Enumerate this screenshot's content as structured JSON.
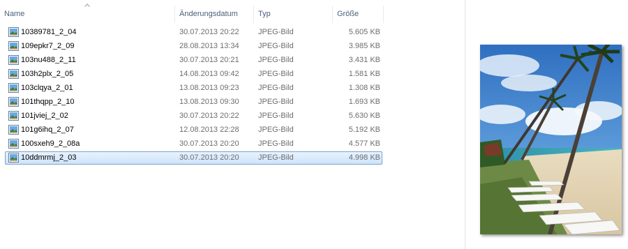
{
  "columns": {
    "name": "Name",
    "date": "Änderungsdatum",
    "type": "Typ",
    "size": "Größe"
  },
  "files": [
    {
      "name": "10389781_2_04",
      "date": "30.07.2013 20:22",
      "type": "JPEG-Bild",
      "size": "5.605 KB"
    },
    {
      "name": "109epkr7_2_09",
      "date": "28.08.2013 13:34",
      "type": "JPEG-Bild",
      "size": "3.985 KB"
    },
    {
      "name": "103nu488_2_11",
      "date": "30.07.2013 20:21",
      "type": "JPEG-Bild",
      "size": "3.431 KB"
    },
    {
      "name": "103h2plx_2_05",
      "date": "14.08.2013 09:42",
      "type": "JPEG-Bild",
      "size": "1.581 KB"
    },
    {
      "name": "103clqya_2_01",
      "date": "13.08.2013 09:23",
      "type": "JPEG-Bild",
      "size": "1.308 KB"
    },
    {
      "name": "101thqpp_2_10",
      "date": "13.08.2013 09:30",
      "type": "JPEG-Bild",
      "size": "1.693 KB"
    },
    {
      "name": "101jviej_2_02",
      "date": "30.07.2013 20:22",
      "type": "JPEG-Bild",
      "size": "5.630 KB"
    },
    {
      "name": "101g6ihq_2_07",
      "date": "12.08.2013 22:28",
      "type": "JPEG-Bild",
      "size": "5.192 KB"
    },
    {
      "name": "100sxeh9_2_08a",
      "date": "30.07.2013 20:20",
      "type": "JPEG-Bild",
      "size": "4.577 KB"
    },
    {
      "name": "10ddmrmj_2_03",
      "date": "30.07.2013 20:20",
      "type": "JPEG-Bild",
      "size": "4.998 KB"
    }
  ],
  "selected_index": 9,
  "file_icon": "image-file-icon",
  "preview_image": "beach-palm-trees-sunloungers",
  "colors": {
    "header_text": "#4c607a",
    "selection_border": "#7da2ce",
    "selection_fill": "#cde3fb"
  }
}
